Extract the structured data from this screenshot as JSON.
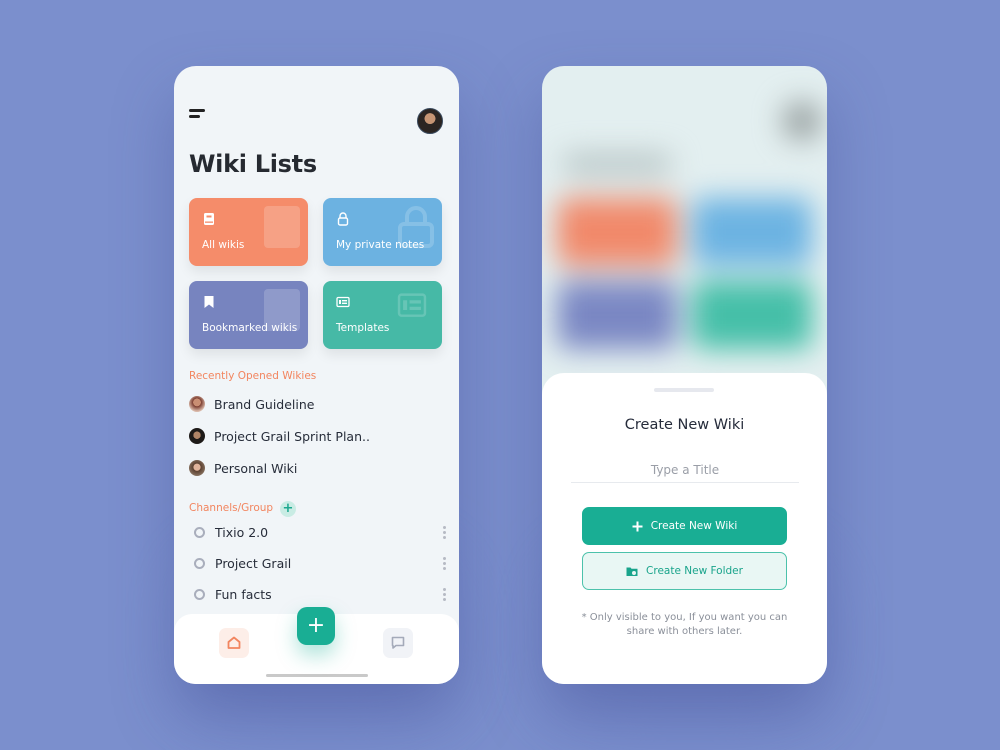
{
  "left_screen": {
    "title": "Wiki Lists",
    "cards": [
      {
        "label": "All wikis",
        "icon": "book-icon",
        "color": "#f58c6a"
      },
      {
        "label": "My private notes",
        "icon": "lock-icon",
        "color": "#6cb2e1"
      },
      {
        "label": "Bookmarked wikis",
        "icon": "bookmark-icon",
        "color": "#7784bf"
      },
      {
        "label": "Templates",
        "icon": "template-icon",
        "color": "#46b9a6"
      }
    ],
    "recent_label": "Recently Opened Wikies",
    "recent": [
      {
        "label": "Brand Guideline"
      },
      {
        "label": "Project Grail Sprint Plan.."
      },
      {
        "label": "Personal Wiki"
      }
    ],
    "channels_label": "Channels/Group",
    "add_channel": "+",
    "channels": [
      {
        "label": "Tixio 2.0"
      },
      {
        "label": "Project Grail"
      },
      {
        "label": "Fun facts"
      }
    ],
    "fab": "+"
  },
  "right_screen": {
    "sheet_title": "Create New Wiki",
    "title_placeholder": "Type a Title",
    "primary_button": "Create New Wiki",
    "secondary_button": "Create New Folder",
    "note": "* Only visible to you, If you want you can share with others later."
  },
  "colors": {
    "accent": "#19ae94",
    "section_label": "#f2855f",
    "background": "#7b8fcd"
  }
}
